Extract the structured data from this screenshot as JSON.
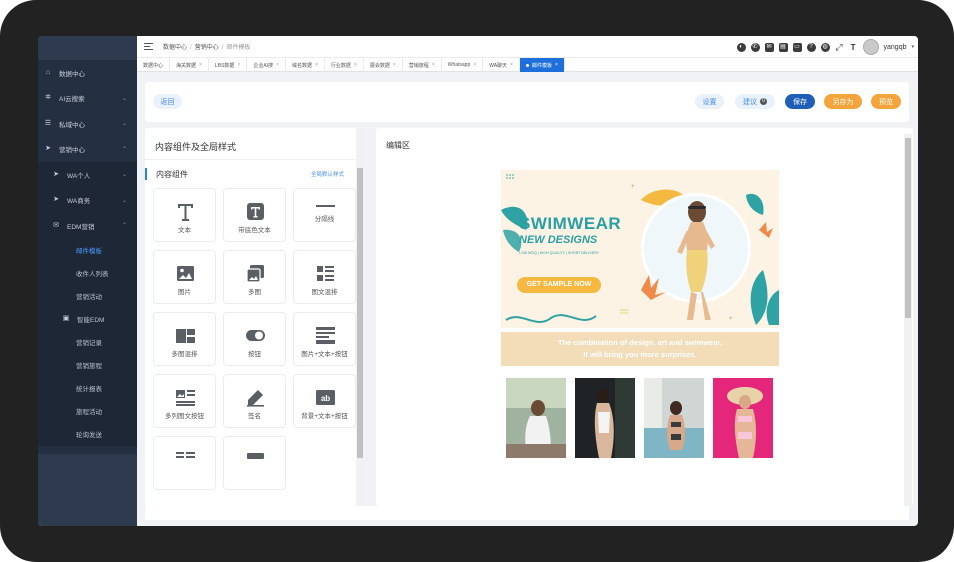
{
  "sidebar": {
    "items": [
      {
        "label": "数据中心",
        "icon": "home-icon",
        "has_chevron": false
      },
      {
        "label": "AI云搜索",
        "icon": "settings-icon",
        "has_chevron": true
      },
      {
        "label": "私域中心",
        "icon": "list-icon",
        "has_chevron": true
      },
      {
        "label": "营销中心",
        "icon": "send-icon",
        "has_chevron": true
      }
    ],
    "marketing": {
      "children": [
        {
          "label": "WA个人",
          "icon": "send-icon"
        },
        {
          "label": "WA商务",
          "icon": "send-icon"
        },
        {
          "label": "EDM营销",
          "icon": "mail-icon"
        }
      ],
      "edm_children": [
        "邮件模板",
        "收件人列表",
        "营销活动"
      ],
      "smart_edm": "智能EDM",
      "smart_children": [
        "营销记录",
        "营销旅程",
        "统计报表",
        "旅程活动",
        "轮询发送"
      ]
    }
  },
  "topbar": {
    "breadcrumb": [
      "数据中心",
      "营销中心",
      "邮件模板"
    ],
    "username": "yangqb"
  },
  "tabs": [
    {
      "label": "数据中心",
      "closable": false
    },
    {
      "label": "海关数据",
      "closable": true
    },
    {
      "label": "LBS数据",
      "closable": true
    },
    {
      "label": "企业AI搜",
      "closable": true
    },
    {
      "label": "域名数据",
      "closable": true
    },
    {
      "label": "行业数据",
      "closable": true
    },
    {
      "label": "展会数据",
      "closable": true
    },
    {
      "label": "营销旅程",
      "closable": true
    },
    {
      "label": "Whatsapp",
      "closable": true
    },
    {
      "label": "WA聊天",
      "closable": true
    },
    {
      "label": "邮件模板",
      "closable": true,
      "active": true
    }
  ],
  "actions": {
    "back": "返回",
    "settings": "设置",
    "suggest": "建议",
    "suggest_count": "0",
    "save": "保存",
    "save_as": "另存为",
    "preview": "预览"
  },
  "left_panel": {
    "title": "内容组件及全局样式",
    "section": "内容组件",
    "global_link": "全局默认样式",
    "components": [
      {
        "label": "文本",
        "icon": "text-icon"
      },
      {
        "label": "带底色文本",
        "icon": "text-box-icon"
      },
      {
        "label": "分隔线",
        "icon": "divider-icon"
      },
      {
        "label": "图片",
        "icon": "image-icon"
      },
      {
        "label": "多图",
        "icon": "multi-image-icon"
      },
      {
        "label": "图文混排",
        "icon": "image-text-icon"
      },
      {
        "label": "多图混排",
        "icon": "multi-image-layout-icon"
      },
      {
        "label": "按钮",
        "icon": "toggle-button-icon"
      },
      {
        "label": "图片+文本+按钮",
        "icon": "image-text-button-icon"
      },
      {
        "label": "多列图文按钮",
        "icon": "columns-icon"
      },
      {
        "label": "签名",
        "icon": "pen-icon"
      },
      {
        "label": "背景+文本+按钮",
        "icon": "ab-text-icon"
      }
    ]
  },
  "editor": {
    "title": "编辑区",
    "banner": {
      "headline": "SWIMWEAR",
      "subhead": "NEW DESIGNS",
      "tagline": "LOW MOQ | HIGH QUALITY | SHORT DELIVERY",
      "cta": "GET SAMPLE NOW"
    },
    "strip_lines": [
      "The combination of design, art and swimwear.",
      "It will bring you more surprises."
    ]
  },
  "colors": {
    "sidebar": "#243042",
    "accent": "#1e6fd9",
    "save": "#1f5fb8",
    "orange": "#f5a43b",
    "banner_bg": "#fcf3e4",
    "teal": "#2fa3a3"
  }
}
